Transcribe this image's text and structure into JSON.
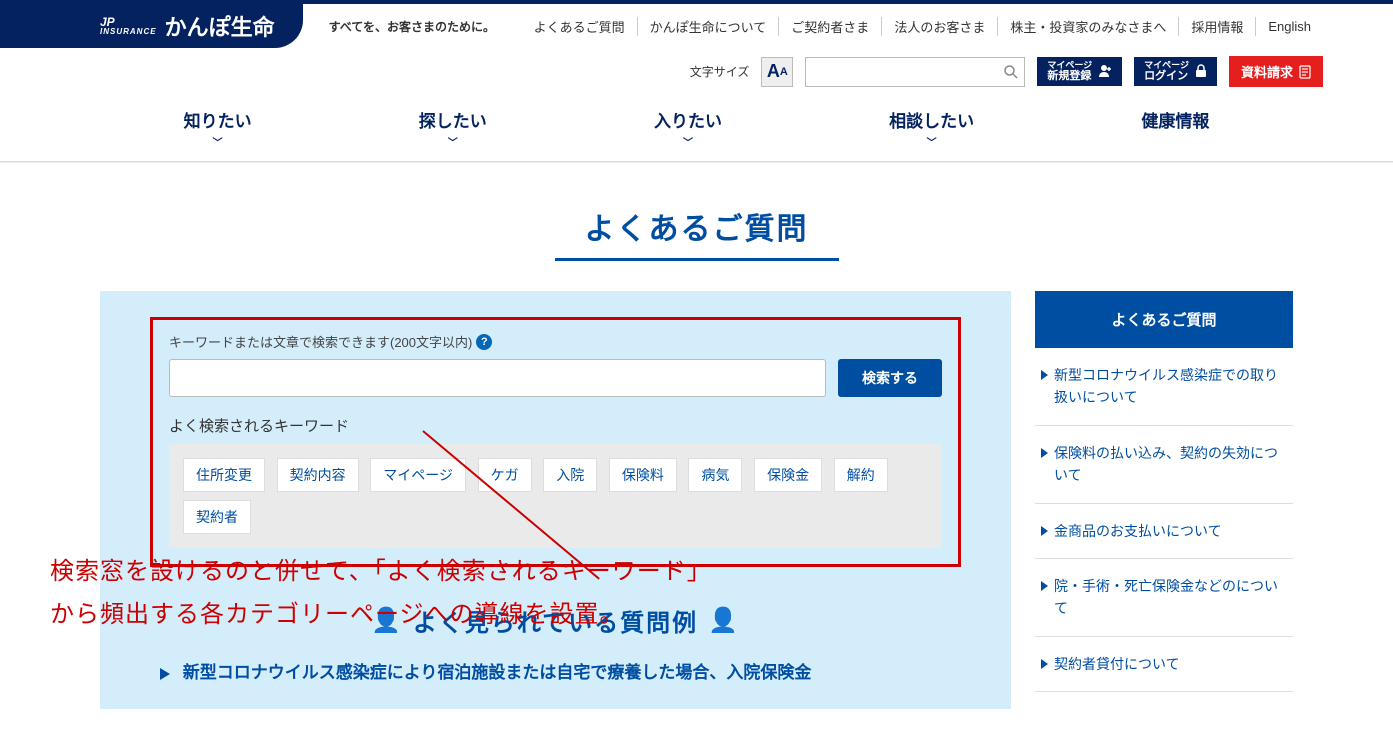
{
  "header": {
    "logo_small_top": "JP",
    "logo_small_bottom": "INSURANCE",
    "brand": "かんぽ生命",
    "tagline": "すべてを、お客さまのために。",
    "toplinks": [
      "よくあるご質問",
      "かんぽ生命について",
      "ご契約者さま",
      "法人のお客さま",
      "株主・投資家のみなさまへ",
      "採用情報",
      "English"
    ],
    "font_size_label": "文字サイズ",
    "mypage_small": "マイページ",
    "mypage_signup": "新規登録",
    "mypage_login": "ログイン",
    "request": "資料請求",
    "nav": [
      "知りたい",
      "探したい",
      "入りたい",
      "相談したい",
      "健康情報"
    ]
  },
  "page": {
    "title": "よくあるご質問",
    "search_label": "キーワードまたは文章で検索できます(200文字以内)",
    "search_button": "検索する",
    "kw_title": "よく検索されるキーワード",
    "keywords": [
      "住所変更",
      "契約内容",
      "マイページ",
      "ケガ",
      "入院",
      "保険料",
      "病気",
      "保険金",
      "解約",
      "契約者"
    ],
    "examples_title": "よく見られている質問例",
    "example_item": "新型コロナウイルス感染症により宿泊施設または自宅で療養した場合、入院保険金"
  },
  "sidebar": {
    "head": "よくあるご質問",
    "items": [
      "新型コロナウイルス感染症での取り扱いについて",
      "保険料の払い込み、契約の失効について",
      "金商品のお支払いについて",
      "院・手術・死亡保険金などのについて",
      "契約者貸付について"
    ]
  },
  "annotation": {
    "line1": "検索窓を設けるのと併せて、「よく検索されるキーワード」",
    "line2": "から頻出する各カテゴリーページへの導線を設置。"
  }
}
